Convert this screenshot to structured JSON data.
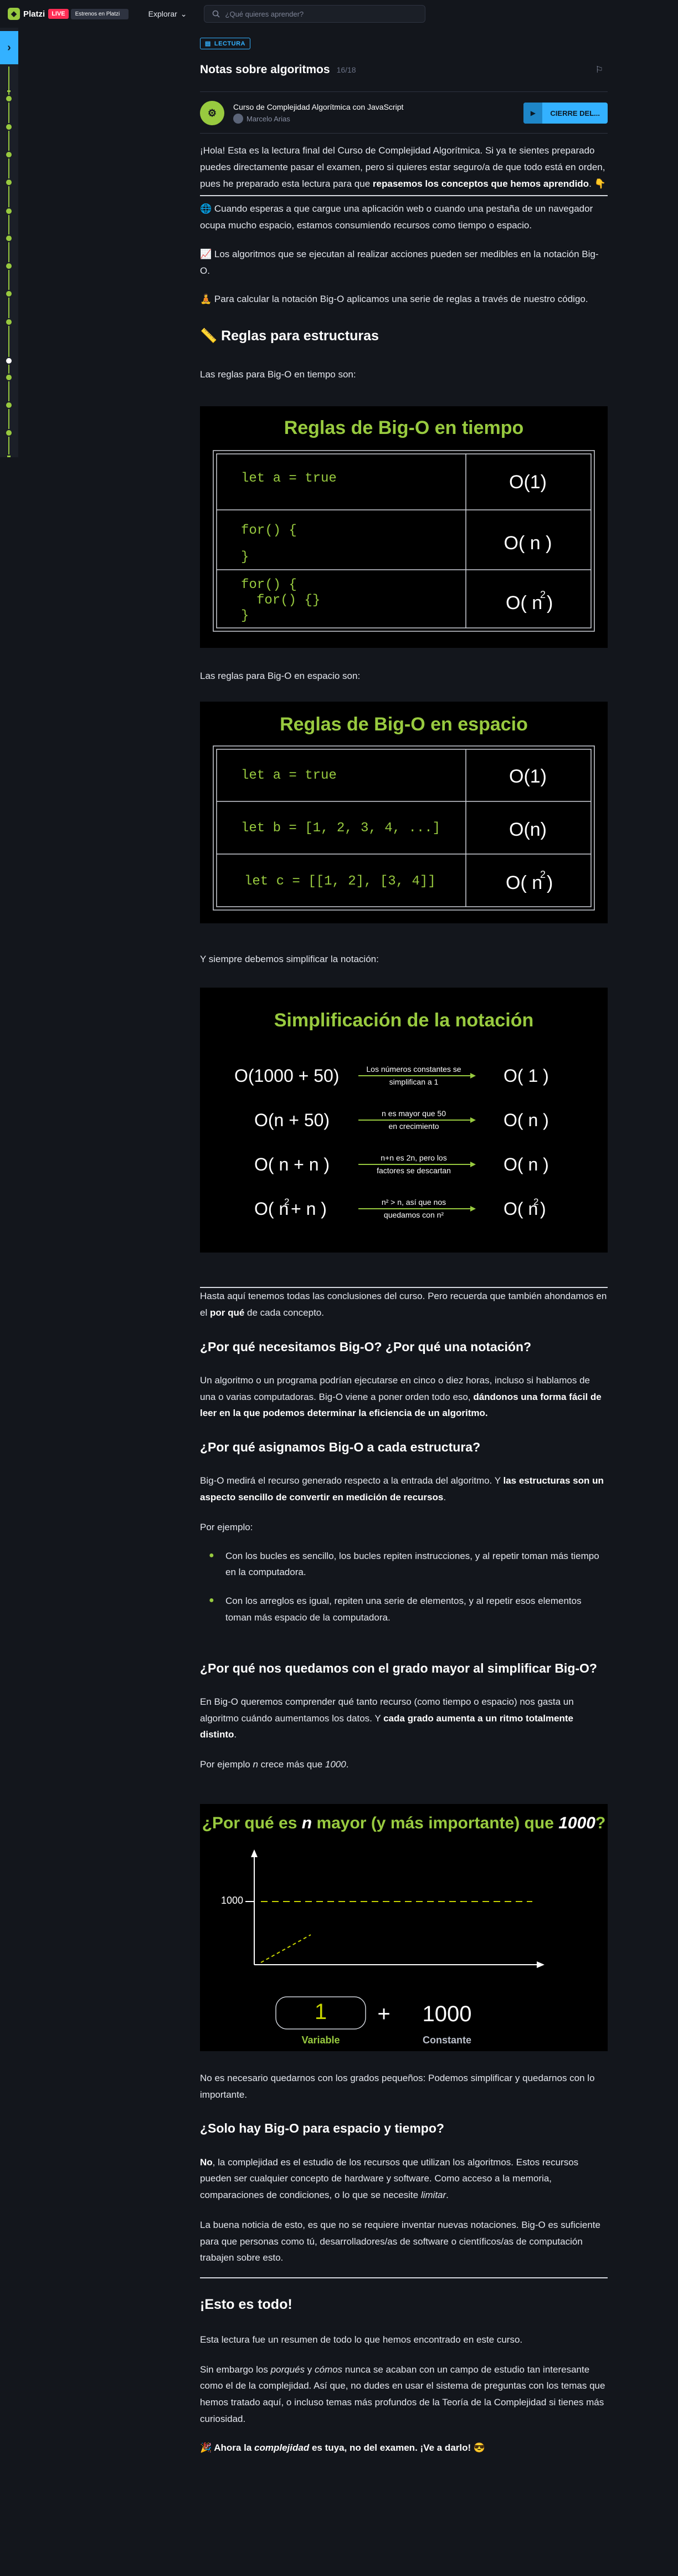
{
  "topbar": {
    "brand": "Platzi",
    "live": "LIVE",
    "streaming": "Estrenos en Platzi",
    "explore": "Explorar",
    "search_placeholder": "¿Qué quieres aprender?"
  },
  "lesson": {
    "tag": "LECTURA",
    "title": "Notas sobre algoritmos",
    "count": "16/18",
    "course_name": "Curso de Complejidad Algorítmica con JavaScript",
    "teacher": "Marcelo Arias",
    "close_button": "CIERRE DEL..."
  },
  "content": {
    "intro_1": "¡Hola! Esta es la lectura final del Curso de Complejidad Algorítmica. Si ya te sientes preparado puedes directamente pasar el examen, pero si quieres estar seguro/a de que todo está en orden, pues he preparado esta lectura para que",
    "intro_1_bold": "repasemos los conceptos que hemos aprendido",
    "intro_1_end": ". 👇",
    "intro_2": "🌐 Cuando esperas a que cargue una aplicación web o cuando una pestaña de un navegador ocupa mucho espacio, estamos consumiendo recursos como tiempo o espacio.",
    "intro_3": "📈 Los algoritmos que se ejecutan al realizar acciones pueden ser medibles en la notación Big-O.",
    "intro_4": "🧘 Para calcular la notación Big-O aplicamos una serie de reglas a través de nuestro código.",
    "h_reglas": "📏 Reglas para estructuras",
    "p_tiempo": "Las reglas para Big-O en tiempo son:",
    "p_espacio": "Las reglas para Big-O en espacio son:",
    "p_simplificar": "Y siempre debemos simplificar la notación:",
    "p_conclusion": "Hasta aquí tenemos todas las conclusiones del curso. Pero recuerda que también ahondamos en el",
    "p_conclusion_bold": "por qué",
    "p_conclusion_end": "de cada concepto.",
    "h_why_bigo": "¿Por qué necesitamos Big-O? ¿Por qué una notación?",
    "p_why_bigo": "Un algoritmo o un programa podrían ejecutarse en cinco o diez horas, incluso si hablamos de una o varias computadoras. Big-O viene a poner orden todo eso,",
    "p_why_bigo_bold": "dándonos una forma fácil de leer en la que podemos determinar la eficiencia de un algoritmo.",
    "h_why_assign": "¿Por qué asignamos Big-O a cada estructura?",
    "p_why_assign": "Big-O medirá el recurso generado respecto a la entrada del algoritmo. Y",
    "p_why_assign_bold": "las estructuras son un aspecto sencillo de convertir en medición de recursos",
    "p_why_assign_end": ".",
    "p_ejemplo": "Por ejemplo:",
    "bullet_1": "Con los bucles es sencillo, los bucles repiten instrucciones, y al repetir toman más tiempo en la computadora.",
    "bullet_2": "Con los arreglos es igual, repiten una serie de elementos, y al repetir esos elementos toman más espacio de la computadora.",
    "h_grado_mayor": "¿Por qué nos quedamos con el grado mayor al simplificar Big-O?",
    "p_grado_1": "En Big-O queremos comprender qué tanto recurso (como tiempo o espacio) nos gasta un algoritmo cuándo aumentamos los datos. Y",
    "p_grado_1_bold": "cada grado aumenta a un ritmo totalmente distinto",
    "p_grado_1_end": ".",
    "p_grado_2": "Por ejemplo",
    "p_grado_2_i": "n",
    "p_grado_2_mid": "crece más que",
    "p_grado_2_i2": "1000",
    "p_grado_2_end": ".",
    "p_no_necesario": "No es necesario quedarnos con los grados pequeños: Podemos simplificar y quedarnos con lo importante.",
    "h_solo": "¿Solo hay Big-O para espacio y tiempo?",
    "p_solo_bold": "No",
    "p_solo": ", la complejidad es el estudio de los recursos que utilizan los algoritmos. Estos recursos pueden ser cualquier concepto de hardware y software. Como acceso a la memoria, comparaciones de condiciones, o lo que se necesite",
    "p_solo_i": "limitar",
    "p_solo_end": ".",
    "p_buena": "La buena noticia de esto, es que no se requiere inventar nuevas notaciones. Big-O es suficiente para que personas como tú, desarrolladores/as de software o científicos/as de computación trabajen sobre esto.",
    "h_todo": "¡Esto es todo!",
    "p_resumen": "Esta lectura fue un resumen de todo lo que hemos encontrado en este curso.",
    "p_sin_1": "Sin embargo los",
    "p_sin_i1": "porqués",
    "p_sin_2": "y",
    "p_sin_i2": "cómos",
    "p_sin_3": "nunca se acaban con un campo de estudio tan interesante como el de la complejidad. Así que, no dudes en usar el sistema de preguntas con los temas que hemos tratado aquí, o incluso temas más profundos de la Teoría de la Complejidad si tienes más curiosidad.",
    "p_final_1": "🎉 Ahora la",
    "p_final_i": "complejidad",
    "p_final_2": "es tuya, no del examen. ¡Ve a darlo! 😎"
  },
  "figures": {
    "tiempo": {
      "title": "Reglas de Big-O en tiempo",
      "rows": [
        {
          "code": "let a = true",
          "o": "O(1)"
        },
        {
          "code_1": "for() {",
          "code_2": "}",
          "o": "O( n )"
        },
        {
          "code_1": "for() {",
          "code_2": "for() {}",
          "code_3": "}",
          "o": "O( n",
          "sup": "2",
          "o_end": ")"
        }
      ]
    },
    "espacio": {
      "title": "Reglas de Big-O en espacio",
      "rows": [
        {
          "code": "let a = true",
          "o": "O(1)"
        },
        {
          "code": "let b = [1, 2, 3, 4, ...]",
          "o": "O(n)"
        },
        {
          "code": "let c = [[1, 2], [3, 4]]",
          "o": "O( n",
          "sup": "2",
          "o_end": ")"
        }
      ]
    },
    "simplificacion": {
      "title": "Simplificación de la notación",
      "rows": [
        {
          "left": "O(1000 + 50)",
          "note_1": "Los números constantes se",
          "note_2": "simplifican a 1",
          "right": "O( 1 )"
        },
        {
          "left": "O(n + 50)",
          "note_1": "n es mayor que 50",
          "note_2": "en crecimiento",
          "right": "O( n )"
        },
        {
          "left": "O( n + n )",
          "note_1": "n+n es 2n, pero los",
          "note_2": "factores se descartan",
          "right": "O( n )"
        },
        {
          "left_a": "O( n",
          "left_sup": "2",
          "left_b": "+ n )",
          "note_1": "n² > n, así que nos",
          "note_2": "quedamos con n²",
          "right_a": "O( n",
          "right_sup": "2",
          "right_b": ")"
        }
      ]
    },
    "porque": {
      "title_1": "¿Por qué es",
      "title_n": "n",
      "title_2": "mayor (y más importante) que",
      "title_1000": "1000",
      "title_3": "?",
      "axis_label": "1000",
      "var_value": "1",
      "plus": "+",
      "const_value": "1000",
      "var_label": "Variable",
      "const_label": "Constante"
    }
  },
  "colors": {
    "accent": "#98ca3f",
    "blue": "#33b1ff",
    "background": "#13161c"
  }
}
